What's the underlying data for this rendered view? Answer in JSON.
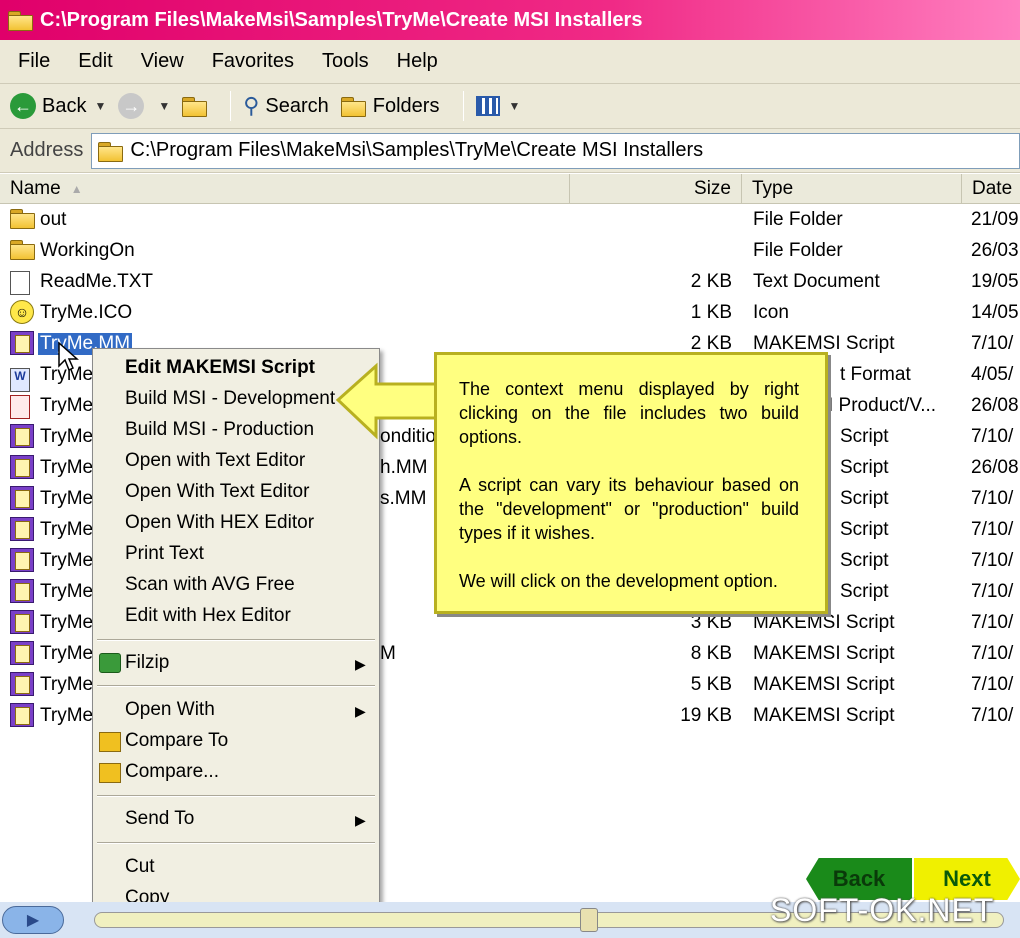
{
  "window": {
    "title": "C:\\Program Files\\MakeMsi\\Samples\\TryMe\\Create MSI Installers"
  },
  "menubar": [
    "File",
    "Edit",
    "View",
    "Favorites",
    "Tools",
    "Help"
  ],
  "toolbar": {
    "back": "Back",
    "search": "Search",
    "folders": "Folders"
  },
  "address": {
    "label": "Address",
    "value": "C:\\Program Files\\MakeMsi\\Samples\\TryMe\\Create MSI Installers"
  },
  "columns": {
    "name": "Name",
    "size": "Size",
    "type": "Type",
    "date": "Date"
  },
  "files": [
    {
      "name": "out",
      "size": "",
      "type": "File Folder",
      "date": "21/09",
      "icon": "folder-icon"
    },
    {
      "name": "WorkingOn",
      "size": "",
      "type": "File Folder",
      "date": "26/03",
      "icon": "folder-icon"
    },
    {
      "name": "ReadMe.TXT",
      "size": "2 KB",
      "type": "Text Document",
      "date": "19/05",
      "icon": "text-file-icon"
    },
    {
      "name": "TryMe.ICO",
      "size": "1 KB",
      "type": "Icon",
      "date": "14/05",
      "icon": "smiley-icon"
    },
    {
      "name": "TryMe.MM",
      "size": "2 KB",
      "type": "MAKEMSI Script",
      "date": "7/10/",
      "icon": "makemsi-script-icon"
    },
    {
      "name": "TryMe",
      "size": "",
      "type": "t Format",
      "date": "4/05/",
      "icon": "word-document-icon"
    },
    {
      "name": "TryMe",
      "size": "",
      "type": "I Product/V...",
      "date": "26/08",
      "icon": "msi-package-icon"
    },
    {
      "name": "TryMe",
      "size": "",
      "type": "Script",
      "date": "7/10/",
      "icon": "makemsi-script-icon",
      "partial": "onditio"
    },
    {
      "name": "TryMe",
      "size": "",
      "type": "Script",
      "date": "26/08",
      "icon": "makemsi-script-icon",
      "partial": "h.MM"
    },
    {
      "name": "TryMe",
      "size": "",
      "type": "Script",
      "date": "7/10/",
      "icon": "makemsi-script-icon",
      "partial": "s.MM"
    },
    {
      "name": "TryMe",
      "size": "",
      "type": "Script",
      "date": "7/10/",
      "icon": "makemsi-script-icon"
    },
    {
      "name": "TryMe",
      "size": "",
      "type": "Script",
      "date": "7/10/",
      "icon": "makemsi-script-icon"
    },
    {
      "name": "TryMe",
      "size": "",
      "type": "Script",
      "date": "7/10/",
      "icon": "makemsi-script-icon"
    },
    {
      "name": "TryMe",
      "size": "3 KB",
      "type": "MAKEMSI Script",
      "date": "7/10/",
      "icon": "makemsi-script-icon"
    },
    {
      "name": "TryMe",
      "size": "8 KB",
      "type": "MAKEMSI Script",
      "date": "7/10/",
      "icon": "makemsi-script-icon",
      "partial": "M"
    },
    {
      "name": "TryMe",
      "size": "5 KB",
      "type": "MAKEMSI Script",
      "date": "7/10/",
      "icon": "makemsi-script-icon"
    },
    {
      "name": "TryMe",
      "size": "19 KB",
      "type": "MAKEMSI Script",
      "date": "7/10/",
      "icon": "makemsi-script-icon"
    }
  ],
  "context_menu": {
    "edit": "Edit MAKEMSI Script",
    "build_dev": "Build MSI - Development",
    "build_prod": "Build MSI - Production",
    "open_text1": "Open with Text Editor",
    "open_text2": "Open With Text Editor",
    "open_hex": "Open With HEX  Editor",
    "print": "Print Text",
    "scan": "Scan with AVG Free",
    "edit_hex": "Edit with Hex Editor",
    "filzip": "Filzip",
    "open_with": "Open With",
    "compare_to": "Compare To",
    "compare": "Compare...",
    "send_to": "Send To",
    "cut": "Cut",
    "copy": "Copy"
  },
  "callout": {
    "p1": "The context menu displayed by right clicking on the file includes two build options.",
    "p2": "A script can vary its behaviour based on the \"development\" or \"production\" build types if it wishes.",
    "p3": "We will click on the development option."
  },
  "nav": {
    "back": "Back",
    "next": "Next"
  },
  "watermark": "SOFT-OK.NET",
  "colors": {
    "title_bar": "#e0006a",
    "selection": "#316ac5",
    "callout": "#ffff80"
  }
}
